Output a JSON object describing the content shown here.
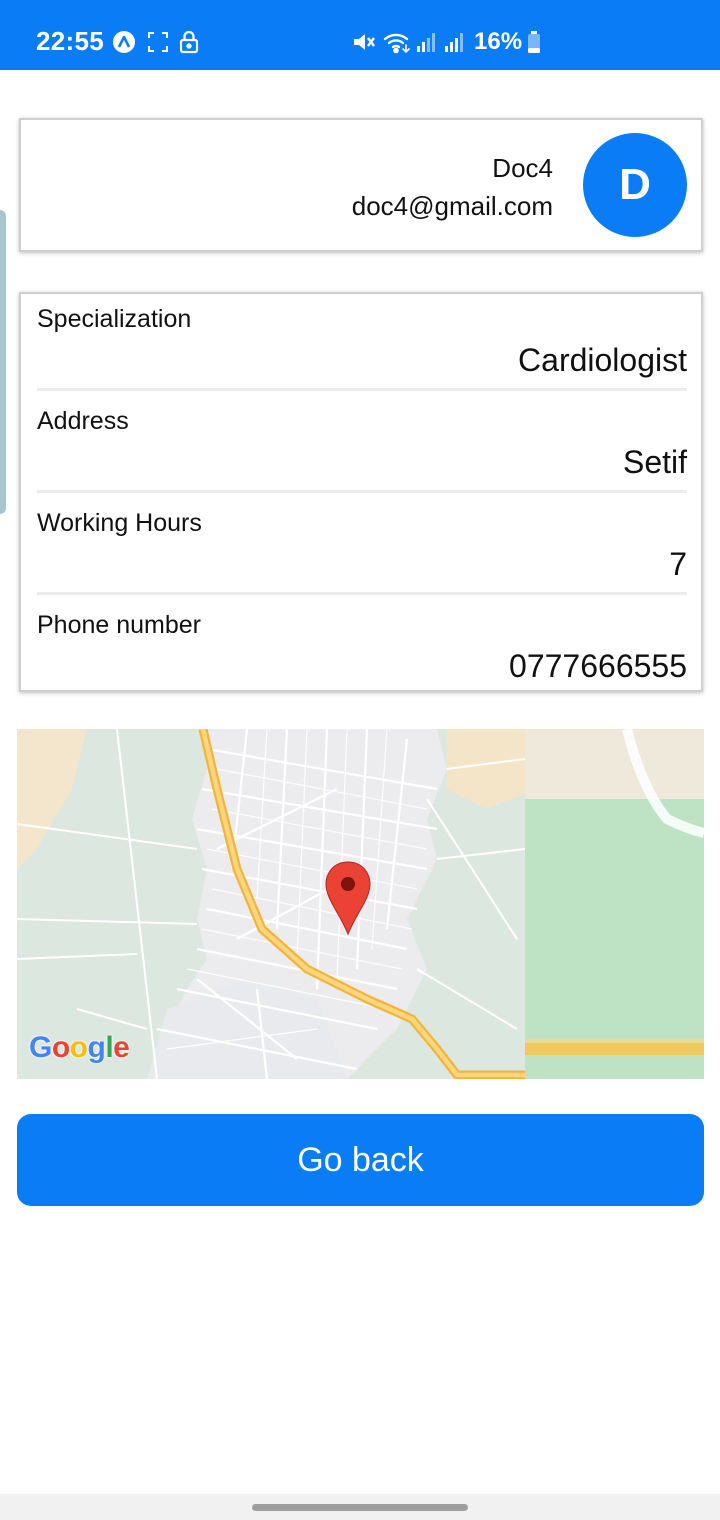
{
  "status_bar": {
    "time": "22:55",
    "battery_percent": "16%",
    "icons": [
      "nav-app-icon",
      "screenshot-frame-icon",
      "lock-icon",
      "mute-icon",
      "wifi-icon",
      "signal-icon",
      "signal-icon",
      "battery-icon"
    ],
    "background_color": "#0a7cf5"
  },
  "profile": {
    "name": "Doc4",
    "email": "doc4@gmail.com",
    "avatar_initial": "D",
    "avatar_color": "#0a7cf5"
  },
  "details": [
    {
      "label": "Specialization",
      "value": "Cardiologist"
    },
    {
      "label": "Address",
      "value": "Setif"
    },
    {
      "label": "Working Hours",
      "value": "7"
    },
    {
      "label": "Phone number",
      "value": "0777666555"
    }
  ],
  "map": {
    "provider_logo": "Google",
    "marker_icon": "map-pin-icon"
  },
  "actions": {
    "go_back_label": "Go back"
  }
}
